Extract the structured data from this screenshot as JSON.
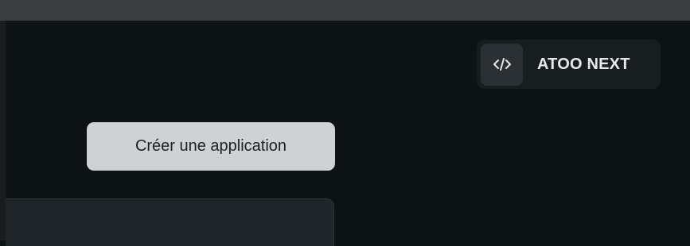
{
  "header": {
    "workspace_name": "ATOO NEXT",
    "workspace_icon": "code-icon"
  },
  "main": {
    "create_app_label": "Créer une application"
  },
  "colors": {
    "background": "#0d1214",
    "top_strip": "#3b3d40",
    "button_bg": "#cfd2d4",
    "badge_bg": "#181d20",
    "panel_bg": "#1f2529"
  }
}
